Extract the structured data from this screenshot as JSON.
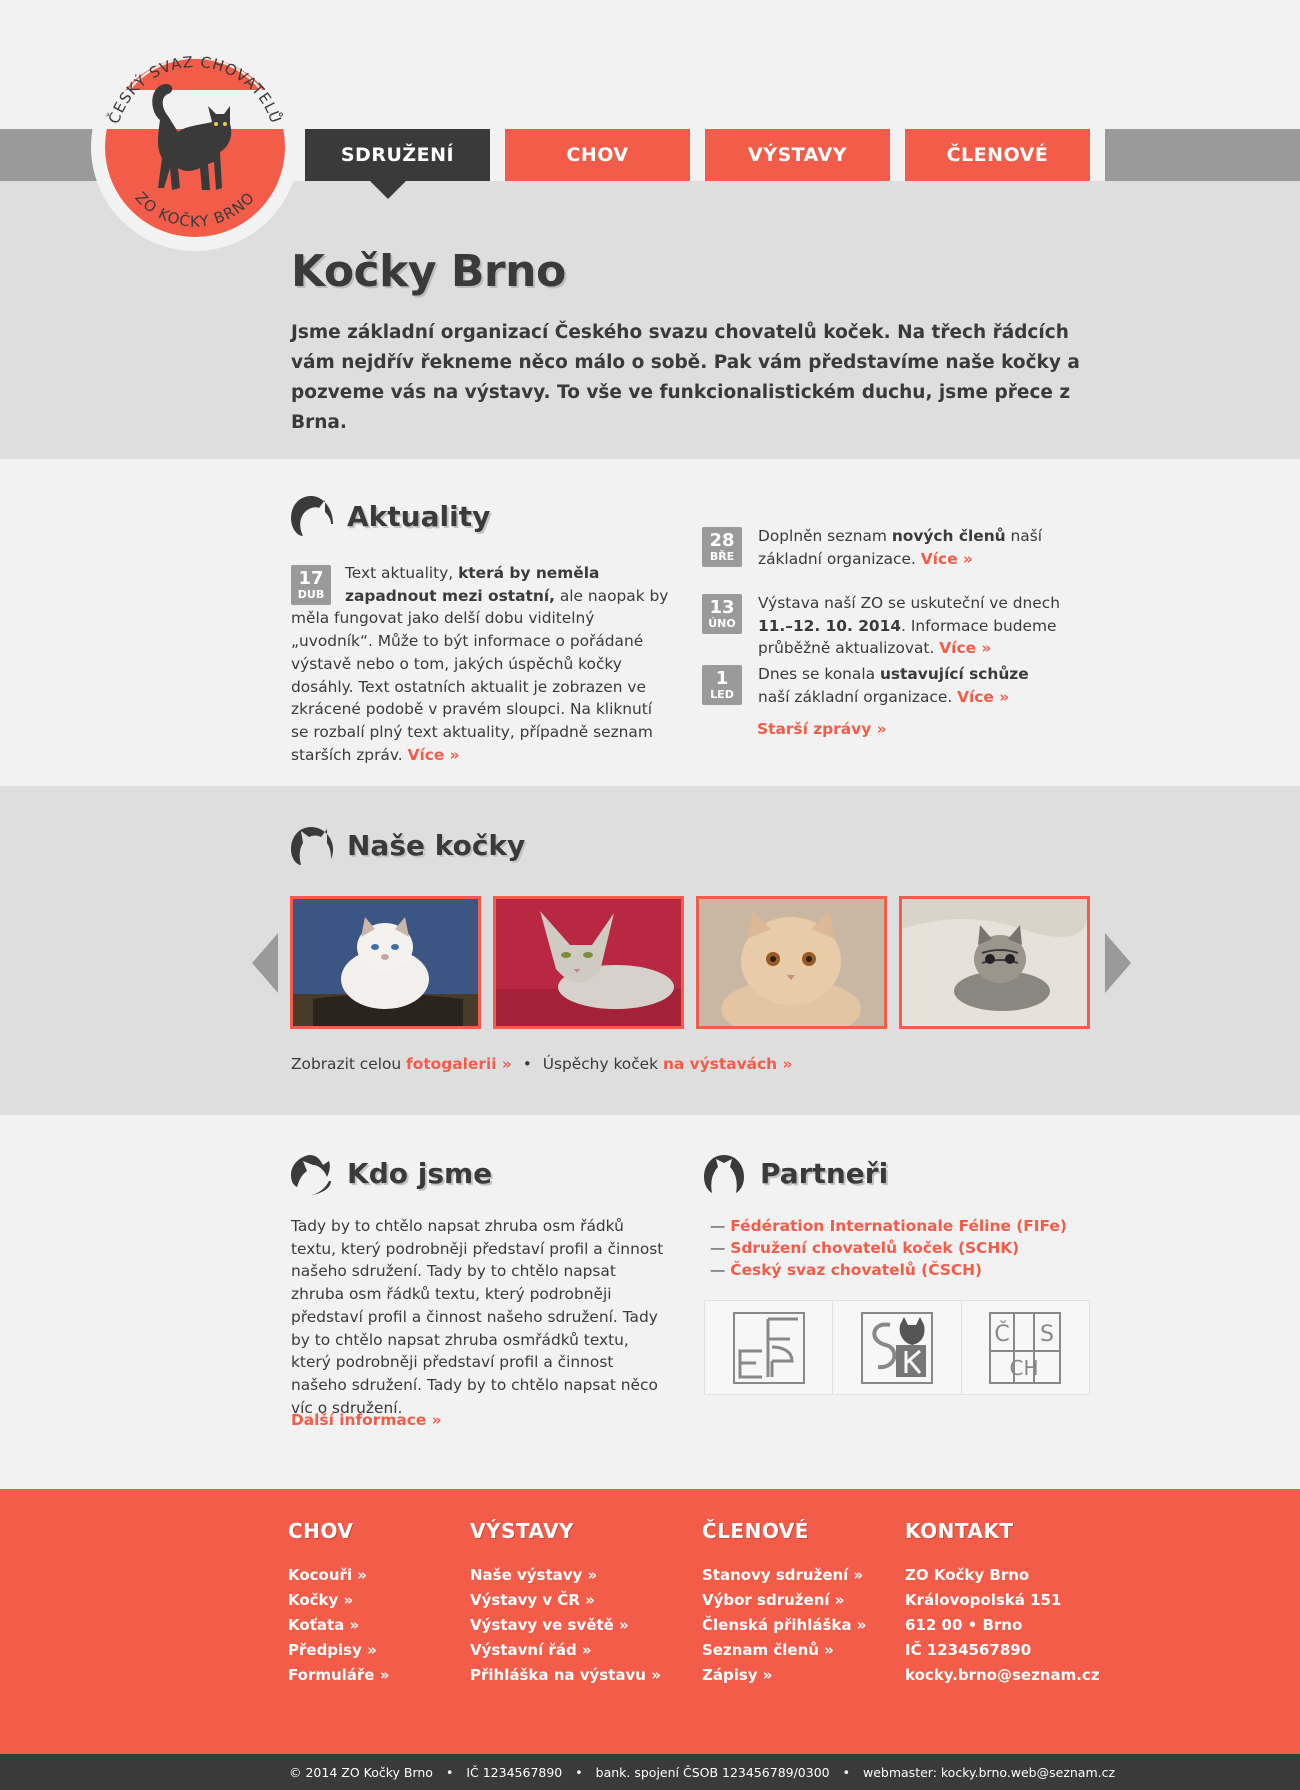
{
  "logo": {
    "arc_top": "ČESKÝ SVAZ CHOVATELŮ",
    "arc_bottom": "ZO KOČKY BRNO"
  },
  "nav": [
    {
      "label": "SDRUŽENÍ",
      "active": true
    },
    {
      "label": "CHOV",
      "active": false
    },
    {
      "label": "VÝSTAVY",
      "active": false
    },
    {
      "label": "ČLENOVÉ",
      "active": false
    }
  ],
  "hero": {
    "title": "Kočky Brno",
    "intro": "Jsme základní organizací Českého svazu chovatelů koček.  Na třech řádcích vám nejdřív řekneme něco málo o sobě.  Pak vám představíme naše kočky a pozveme vás na výstavy.  To vše ve funkcionalistickém duchu, jsme přece z Brna."
  },
  "news": {
    "title": "Aktuality",
    "main": {
      "day": "17",
      "month": "DUB",
      "text_before": "Text aktuality, ",
      "bold": "která by neměla zapadnout mezi ostatní,",
      "text_after": " ale naopak by měla fungovat jako delší dobu viditelný „uvodník“. Může to být informace o pořádané výstavě nebo o tom, jakých úspěchů kočky dosáhly. Text ostatních aktualit je zobrazen ve zkrácené podobě v pravém sloupci. Na kliknutí se rozbalí plný text aktuality, případně seznam starších zpráv. ",
      "more": "Více »"
    },
    "items": [
      {
        "day": "28",
        "month": "BŘE",
        "before": "Doplněn seznam ",
        "bold": "nových členů",
        "after": " naší základní organizace. ",
        "more": "Více »"
      },
      {
        "day": "13",
        "month": "ÚNO",
        "before": "Výstava naší ZO se uskuteční ve dnech ",
        "bold": "11.–12. 10. 2014",
        "after": ". Informace budeme průběžně aktualizovat. ",
        "more": "Více »"
      },
      {
        "day": "1",
        "month": "LED",
        "before": "Dnes se konala ",
        "bold": "ustavující schůze",
        "after": " naší základní organizace. ",
        "more": "Více »"
      }
    ],
    "older": "Starší zprávy »"
  },
  "gallery": {
    "title": "Naše kočky",
    "links": {
      "prefix1": "Zobrazit celou ",
      "link1": "fotogalerii »",
      "bullet": "•",
      "prefix2": "Úspěchy koček ",
      "link2": "na výstavách »"
    }
  },
  "about": {
    "title": "Kdo jsme",
    "text": "Tady by to chtělo napsat zhruba osm řádků textu, který podrobněji představí profil a činnost našeho sdružení. Tady by to chtělo napsat zhruba osm řádků textu, který podrobněji představí profil a činnost našeho sdružení. Tady by to chtělo napsat zhruba osmřádků textu, který podrobněji představí profil a činnost našeho sdružení. Tady by to chtělo napsat něco víc o sdružení.",
    "more": "Další informace »"
  },
  "partners": {
    "title": "Partneři",
    "items": [
      "Fédération Internationale Féline (FIFe)",
      "Sdružení chovatelů koček (SCHK)",
      "Český svaz chovatelů (ČSCH)"
    ],
    "logo3": {
      "l1": "Č",
      "l2": "S",
      "l3": "CH"
    }
  },
  "footer": {
    "cols": [
      {
        "title": "CHOV",
        "items": [
          "Kocouři »",
          "Kočky »",
          "Koťata »",
          "Předpisy »",
          "Formuláře »"
        ]
      },
      {
        "title": "VÝSTAVY",
        "items": [
          "Naše výstavy »",
          "Výstavy v ČR »",
          "Výstavy ve světě »",
          "Výstavní řád »",
          "Přihláška na výstavu »"
        ]
      },
      {
        "title": "ČLENOVÉ",
        "items": [
          "Stanovy sdružení »",
          "Výbor sdružení »",
          "Členská přihláška »",
          "Seznam členů »",
          "Zápisy »"
        ]
      },
      {
        "title": "KONTAKT",
        "items": [
          "ZO Kočky Brno",
          "Královopolská 151",
          "612 00 • Brno",
          "IČ 1234567890",
          "kocky.brno@seznam.cz"
        ]
      }
    ],
    "bottom": [
      "© 2014 ZO Kočky Brno",
      "IČ 1234567890",
      "bank. spojení ČSOB 123456789/0300",
      "webmaster: kocky.brno.web@seznam.cz"
    ],
    "sep": "•"
  },
  "colors": {
    "accent": "#f35c49",
    "dark": "#3a3a3a",
    "grey": "#9a9a9a",
    "band": "#dedede"
  }
}
